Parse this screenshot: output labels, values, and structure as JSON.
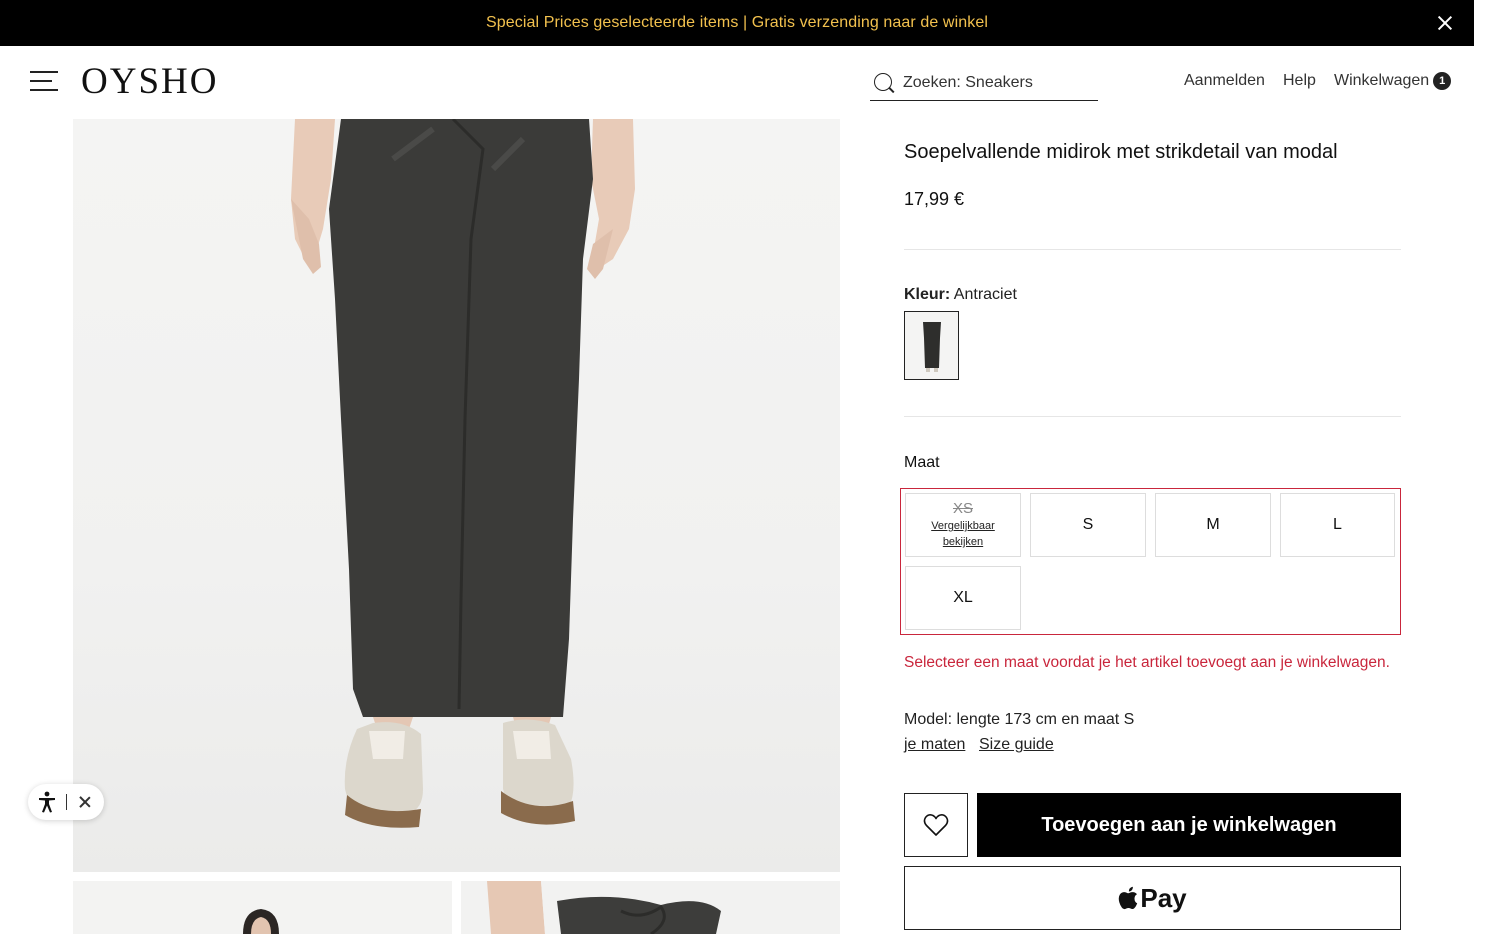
{
  "promo": {
    "text": "Special Prices geselecteerde items | Gratis verzending naar de winkel",
    "close_icon": "close-icon"
  },
  "header": {
    "brand": "OYSHO",
    "search_placeholder": "Zoeken: Sneakers",
    "signin": "Aanmelden",
    "help": "Help",
    "cart": "Winkelwagen",
    "cart_count": "1"
  },
  "product": {
    "title": "Soepelvallende midirok met strikdetail van modal",
    "price": "17,99 €",
    "color_label": "Kleur:",
    "color_value": "Antraciet",
    "size_heading": "Maat",
    "sizes": [
      {
        "label": "XS",
        "available": false,
        "note": "Vergelijkbaar bekijken"
      },
      {
        "label": "S",
        "available": true
      },
      {
        "label": "M",
        "available": true
      },
      {
        "label": "L",
        "available": true
      },
      {
        "label": "XL",
        "available": true
      }
    ],
    "size_error": "Selecteer een maat voordat je het artikel toevoegt aan je winkelwagen.",
    "model_info": "Model: lengte 173 cm en maat S",
    "my_sizes_link": "je maten",
    "size_guide_link": "Size guide",
    "add_to_cart": "Toevoegen aan je winkelwagen",
    "apple_pay": "Pay"
  },
  "colors": {
    "promo_text": "#f2c14e",
    "error": "#c9263c",
    "skirt": "#3b3b39"
  }
}
